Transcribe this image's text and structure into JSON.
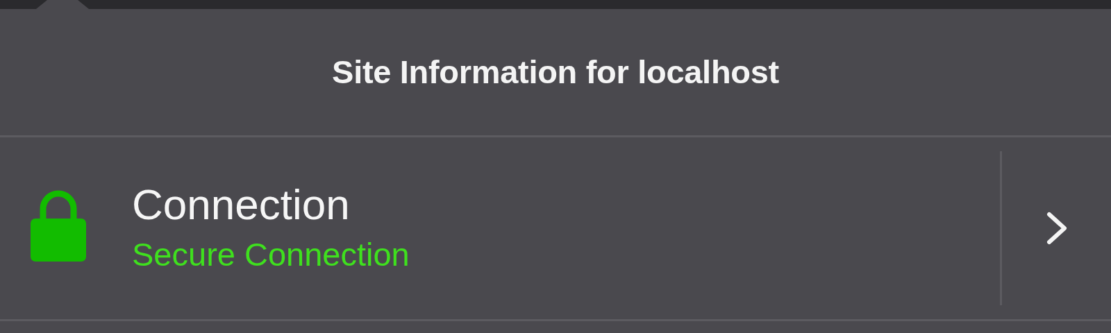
{
  "panel": {
    "title": "Site Information for localhost"
  },
  "connection": {
    "label": "Connection",
    "status": "Secure Connection",
    "secure": true
  }
}
